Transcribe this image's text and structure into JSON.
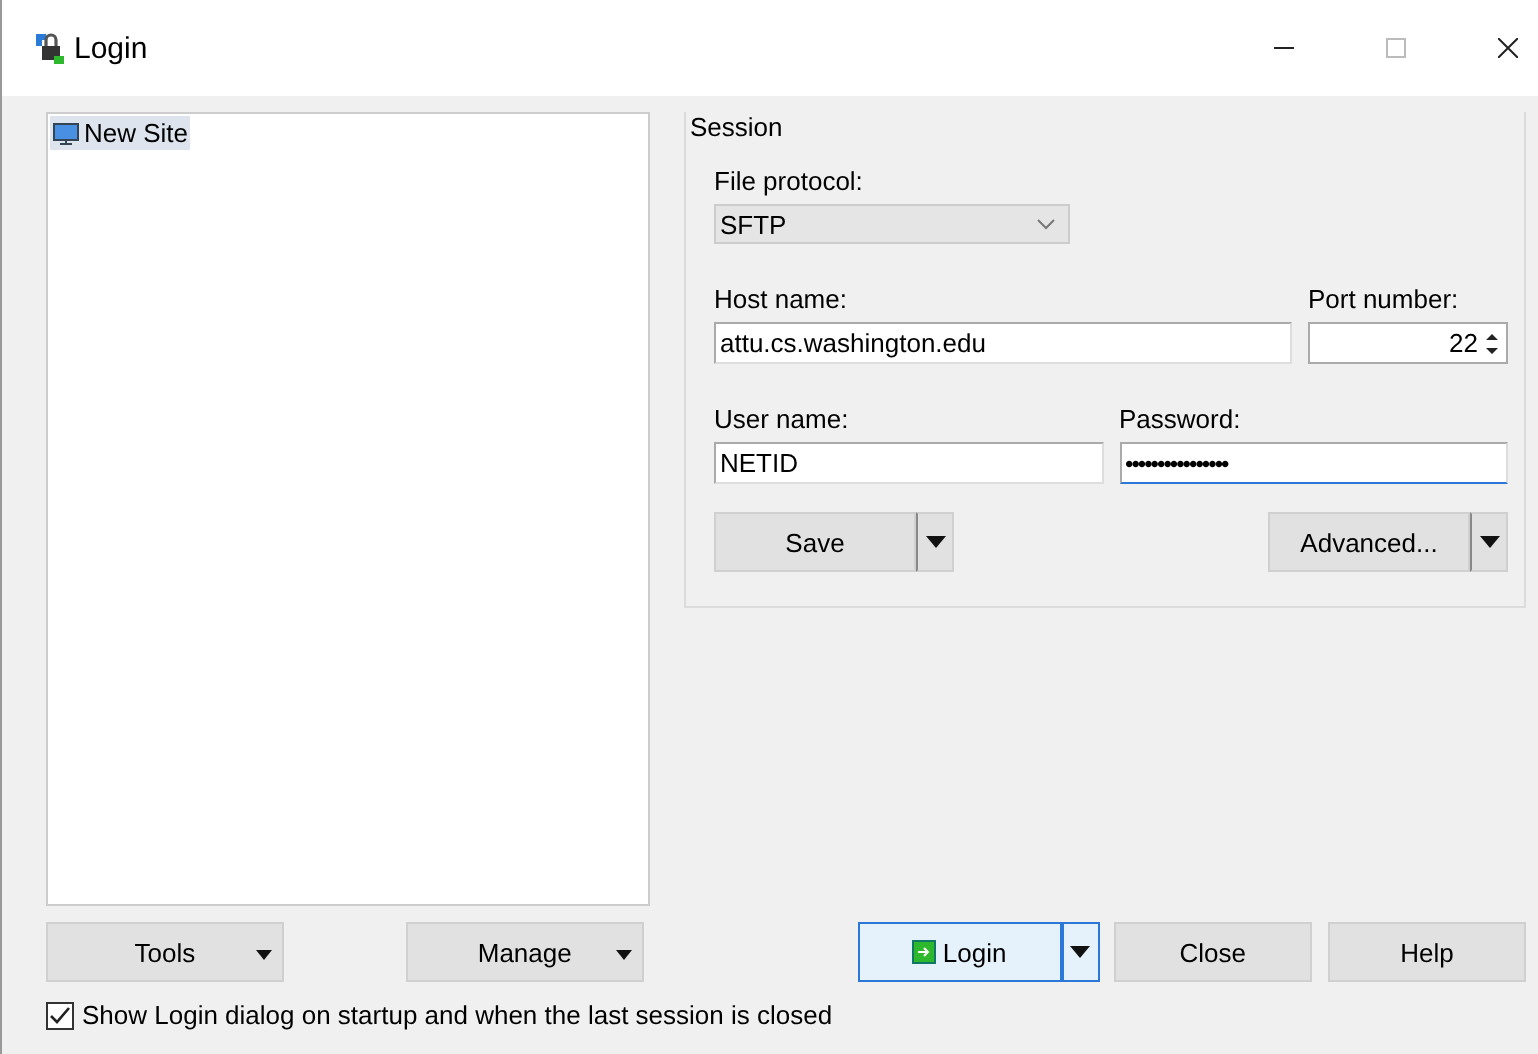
{
  "window": {
    "title": "Login"
  },
  "sites": [
    {
      "label": "New Site",
      "selected": true
    }
  ],
  "session": {
    "title": "Session",
    "file_protocol": {
      "label": "File protocol:",
      "value": "SFTP"
    },
    "host": {
      "label": "Host name:",
      "value": "attu.cs.washington.edu"
    },
    "port": {
      "label": "Port number:",
      "value": "22"
    },
    "user": {
      "label": "User name:",
      "value": "NETID"
    },
    "password": {
      "label": "Password:",
      "value": "••••••••••••••••"
    },
    "save_button": "Save",
    "advanced_button": "Advanced..."
  },
  "tools_button": "Tools",
  "manage_button": "Manage",
  "login_button": "Login",
  "close_button": "Close",
  "help_button": "Help",
  "show_login_checkbox": {
    "label": "Show Login dialog on startup and when the last session is closed",
    "checked": true
  }
}
